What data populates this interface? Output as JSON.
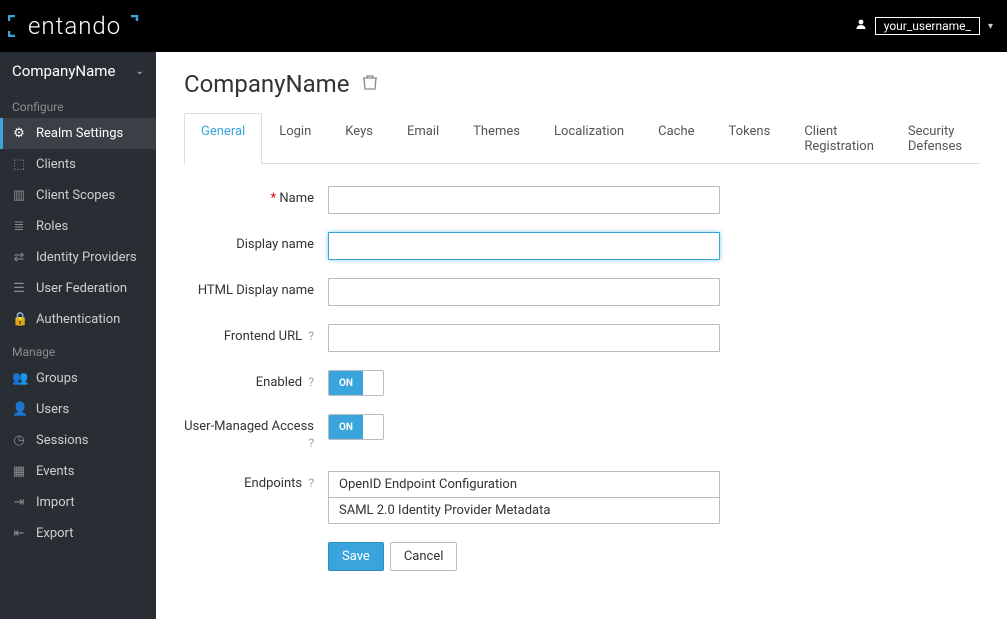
{
  "header": {
    "brand_text": "entando",
    "username": "your_username_"
  },
  "sidebar": {
    "realm_name": "CompanyName",
    "sections": [
      {
        "title": "Configure",
        "items": [
          {
            "key": "realm-settings",
            "label": "Realm Settings",
            "icon": "sliders",
            "active": true
          },
          {
            "key": "clients",
            "label": "Clients",
            "icon": "cube",
            "active": false
          },
          {
            "key": "client-scopes",
            "label": "Client Scopes",
            "icon": "cubes",
            "active": false
          },
          {
            "key": "roles",
            "label": "Roles",
            "icon": "list",
            "active": false
          },
          {
            "key": "identity-providers",
            "label": "Identity Providers",
            "icon": "exchange",
            "active": false
          }
        ]
      },
      {
        "title": "",
        "items": [
          {
            "key": "user-federation",
            "label": "User Federation",
            "icon": "database",
            "active": false
          },
          {
            "key": "authentication",
            "label": "Authentication",
            "icon": "lock",
            "active": false
          }
        ]
      },
      {
        "title": "Manage",
        "items": [
          {
            "key": "groups",
            "label": "Groups",
            "icon": "users",
            "active": false
          },
          {
            "key": "users",
            "label": "Users",
            "icon": "user",
            "active": false
          },
          {
            "key": "sessions",
            "label": "Sessions",
            "icon": "clock",
            "active": false
          },
          {
            "key": "events",
            "label": "Events",
            "icon": "calendar",
            "active": false
          },
          {
            "key": "import",
            "label": "Import",
            "icon": "import",
            "active": false
          },
          {
            "key": "export",
            "label": "Export",
            "icon": "export",
            "active": false
          }
        ]
      }
    ]
  },
  "page": {
    "title": "CompanyName",
    "tabs": [
      {
        "key": "general",
        "label": "General",
        "active": true
      },
      {
        "key": "login",
        "label": "Login",
        "active": false
      },
      {
        "key": "keys",
        "label": "Keys",
        "active": false
      },
      {
        "key": "email",
        "label": "Email",
        "active": false
      },
      {
        "key": "themes",
        "label": "Themes",
        "active": false
      },
      {
        "key": "localization",
        "label": "Localization",
        "active": false
      },
      {
        "key": "cache",
        "label": "Cache",
        "active": false
      },
      {
        "key": "tokens",
        "label": "Tokens",
        "active": false
      },
      {
        "key": "client-reg",
        "label": "Client Registration",
        "active": false
      },
      {
        "key": "security",
        "label": "Security Defenses",
        "active": false
      }
    ],
    "form": {
      "labels": {
        "name": "Name",
        "display_name": "Display name",
        "html_display_name": "HTML Display name",
        "frontend_url": "Frontend URL",
        "enabled": "Enabled",
        "uma": "User-Managed Access",
        "endpoints": "Endpoints"
      },
      "values": {
        "name": "",
        "display_name": "",
        "html_display_name": "",
        "frontend_url": "",
        "enabled": "ON",
        "uma": "ON"
      },
      "endpoints": [
        "OpenID Endpoint Configuration",
        "SAML 2.0 Identity Provider Metadata"
      ],
      "buttons": {
        "save": "Save",
        "cancel": "Cancel"
      }
    }
  }
}
